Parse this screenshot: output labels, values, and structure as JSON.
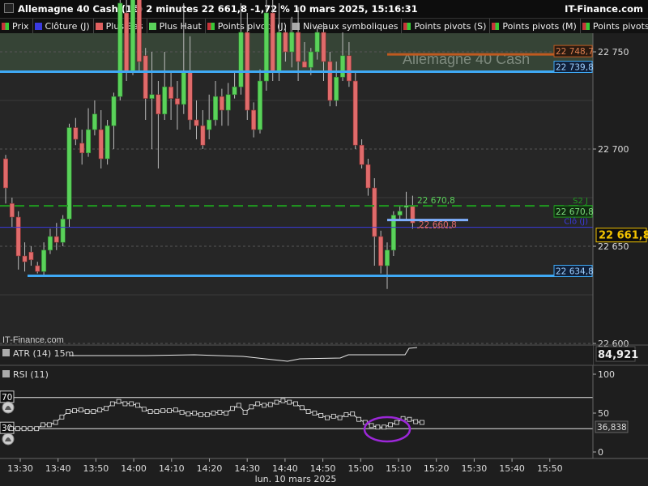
{
  "window": {
    "title": "Allemagne 40 Cash (1€) 2 minutes 22 661,8 -1,72 % 10 mars 2025, 15:16:31",
    "brand": "IT-Finance.com"
  },
  "legend": [
    {
      "label": "Prix",
      "color": "#c8343a",
      "color2": "#37c837"
    },
    {
      "label": "Clôture (J)",
      "color": "#3a3ae0"
    },
    {
      "label": "Plus Bas",
      "color": "#e06060"
    },
    {
      "label": "Plus Haut",
      "color": "#5ad25a"
    },
    {
      "label": "Points pivots (J)",
      "color": "#c8343a",
      "color2": "#37c837"
    },
    {
      "label": "Niveaux symboliques",
      "color": "#aaaaaa"
    },
    {
      "label": "Points pivots (S)",
      "color": "#c8343a",
      "color2": "#37c837"
    },
    {
      "label": "Points pivots (M)",
      "color": "#c8343a",
      "color2": "#37c837"
    },
    {
      "label": "Points pivots",
      "color": "#c8343a",
      "color2": "#37c837"
    }
  ],
  "price_chart": {
    "watermark": "Allemagne 40 Cash",
    "corner_label": "IT-Finance.com",
    "y_ticks": [
      "22 750",
      "22 700",
      "22 650",
      "22 600"
    ],
    "current_price": "22 661,8",
    "levels": {
      "upper_blue": "22 739,8",
      "lower_blue": "22 634,8",
      "top_orange": "22 748,7",
      "s2_value": "22 670,8",
      "s2_label": "S2 J",
      "low_value": "22 660,8",
      "close_label": "Clô (J)"
    },
    "colors": {
      "bull": "#5ad25a",
      "bear": "#e06b6b",
      "blue_line": "#3fa9f5",
      "green_dash": "#1f9a1f",
      "orange": "#c05a20"
    }
  },
  "atr": {
    "label": "ATR (14) 15m",
    "value": "84,921"
  },
  "rsi": {
    "label": "RSI (11)",
    "value": "36,838",
    "levels": [
      "70",
      "30"
    ],
    "y_ticks": [
      "100",
      "50",
      "0"
    ],
    "values": [
      30,
      30,
      30,
      30,
      30,
      35,
      35,
      38,
      45,
      52,
      53,
      54,
      52,
      52,
      54,
      56,
      62,
      65,
      62,
      62,
      60,
      55,
      52,
      52,
      53,
      53,
      54,
      51,
      49,
      50,
      48,
      48,
      50,
      51,
      50,
      56,
      60,
      51,
      58,
      62,
      60,
      61,
      64,
      66,
      64,
      62,
      57,
      52,
      50,
      47,
      44,
      46,
      44,
      48,
      49,
      42,
      38,
      34,
      32,
      32,
      35,
      38,
      43,
      42,
      39,
      38
    ]
  },
  "time_axis": {
    "ticks": [
      "13:30",
      "13:40",
      "13:50",
      "14:00",
      "14:10",
      "14:20",
      "14:30",
      "14:40",
      "14:50",
      "15:00",
      "15:10",
      "15:20",
      "15:30",
      "15:40",
      "15:50"
    ],
    "date": "lun. 10 mars 2025"
  }
}
